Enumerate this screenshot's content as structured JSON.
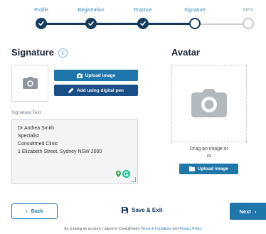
{
  "stepper": {
    "steps": [
      {
        "label": "Profile",
        "state": "done"
      },
      {
        "label": "Registration",
        "state": "done"
      },
      {
        "label": "Practice",
        "state": "done"
      },
      {
        "label": "Signature",
        "state": "current"
      },
      {
        "label": "MFA",
        "state": "upcoming"
      }
    ]
  },
  "signature": {
    "title": "Signature",
    "info_icon": "info-icon",
    "upload_label": "Upload image",
    "pen_label": "Add using digital pen",
    "text_label": "Signature Text",
    "text_lines": [
      "Dr Anthea Smith",
      "Specialist",
      "Consultmed Clinic",
      "1 Elizabeth Street, Sydney NSW 2000"
    ]
  },
  "avatar": {
    "title": "Avatar",
    "drag_text": "Drag an image or",
    "or_text": "or",
    "upload_label": "Upload image"
  },
  "footer": {
    "back_label": "Back",
    "save_label": "Save & Exit",
    "next_label": "Next",
    "terms_prefix": "By creating an account, I agree to Consultmed's ",
    "terms_link": "Terms & Conditions",
    "terms_and": " and ",
    "privacy_link": "Privacy Policy"
  },
  "colors": {
    "primary": "#1f76ab",
    "navy": "#163b5f",
    "pen_button": "#1a4e86",
    "step_label": "#3a87b8"
  }
}
